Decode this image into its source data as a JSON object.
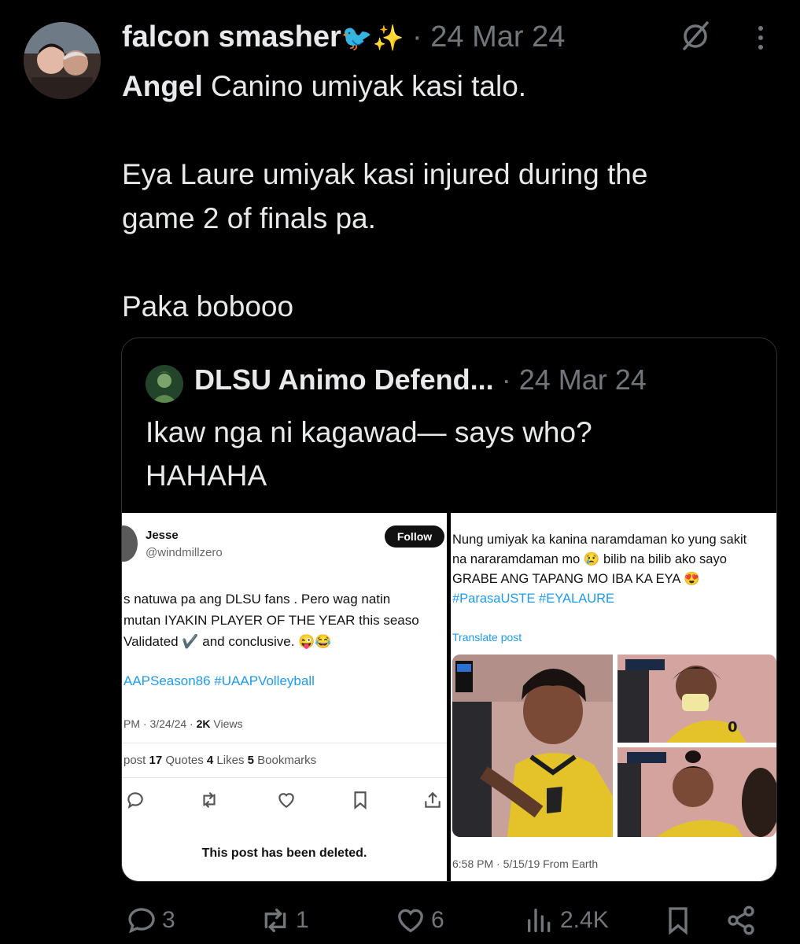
{
  "tweet": {
    "author": "falcon smasher",
    "author_emoji_bird": "🐦",
    "author_emoji_sparkle": "✨",
    "separator": "·",
    "date": "24 Mar 24",
    "mention": "Angel",
    "line1_rest": " Canino umiyak kasi talo.",
    "line2": "Eya Laure umiyak kasi injured during the",
    "line3": "game 2 of finals pa.",
    "line4": "Paka bobooo"
  },
  "quote": {
    "author": "DLSU Animo Defend...",
    "separator": "·",
    "date": "24 Mar 24",
    "line1": "Ikaw nga ni kagawad— says who?",
    "line2": "HAHAHA"
  },
  "left_shot": {
    "name": "Jesse",
    "handle": "@windmillzero",
    "follow_label": "Follow",
    "line1": "s natuwa pa ang DLSU fans . Pero wag natin",
    "line2": "mutan IYAKIN PLAYER OF THE YEAR this seaso",
    "line3": "Validated ✔️ and conclusive. 😜😂",
    "hashtags": "AAPSeason86 #UAAPVolleyball",
    "meta_time": "PM · 3/24/24 · ",
    "meta_views_count": "2K",
    "meta_views_label": " Views",
    "stats_repost": "post ",
    "stats_quotes_count": "17",
    "stats_quotes_label": " Quotes  ",
    "stats_likes_count": "4",
    "stats_likes_label": " Likes  ",
    "stats_bookmarks_count": "5",
    "stats_bookmarks_label": " Bookmarks",
    "deleted_notice": "This post has been deleted."
  },
  "right_shot": {
    "line1": "Nung umiyak ka kanina naramdaman ko yung sakit",
    "line2": "na nararamdaman mo 😢  bilib na bilib ako sayo",
    "line3": "GRABE ANG TAPANG MO IBA KA EYA 😍",
    "hashtags": "#ParasaUSTE #EYALAURE",
    "translate": "Translate post",
    "meta": "6:58 PM · 5/15/19 From Earth"
  },
  "actions": {
    "replies": "3",
    "reposts": "1",
    "likes": "6",
    "views": "2.4K"
  },
  "colors": {
    "background": "#000000",
    "text": "#e7e9ea",
    "muted": "#71767b",
    "link": "#1d9bf0",
    "border": "#2f3336"
  }
}
